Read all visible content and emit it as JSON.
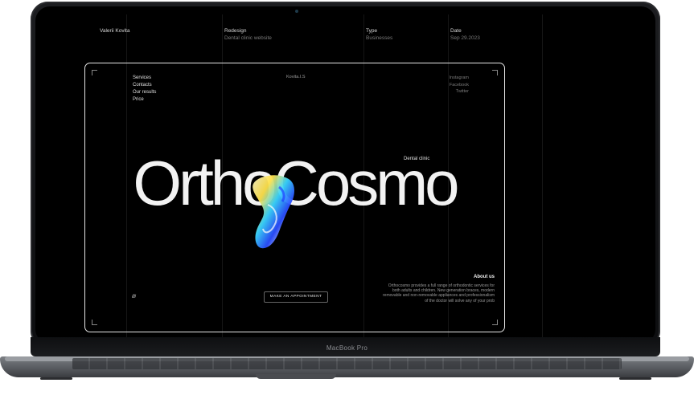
{
  "header": {
    "author": "Valerii Kovita",
    "project_label": "Redesign",
    "project_value": "Dental clinic website",
    "type_label": "Type",
    "type_value": "Businesses",
    "date_label": "Date",
    "date_value": "Sep 29.2023"
  },
  "nav": {
    "items": [
      "Services",
      "Contacts",
      "Our results",
      "Price"
    ]
  },
  "brand_small": "Kovita.I.S",
  "social": {
    "items": [
      "Instagram",
      "Facebook",
      "Twitter"
    ]
  },
  "hero": {
    "title": "OrthoCosmo",
    "tagline": "Dental clinic"
  },
  "about": {
    "heading": "About us",
    "text": "Orthocosmo provides a full range of orthodontic services for both adults and children. New generation braces, modern removable and non-removable appliances and professionalism of the doctor will solve any of your prob"
  },
  "cta_label": "MAKE AN APPOINTMENT",
  "decor_slashes": "////",
  "device_label": "MacBook Pro"
}
